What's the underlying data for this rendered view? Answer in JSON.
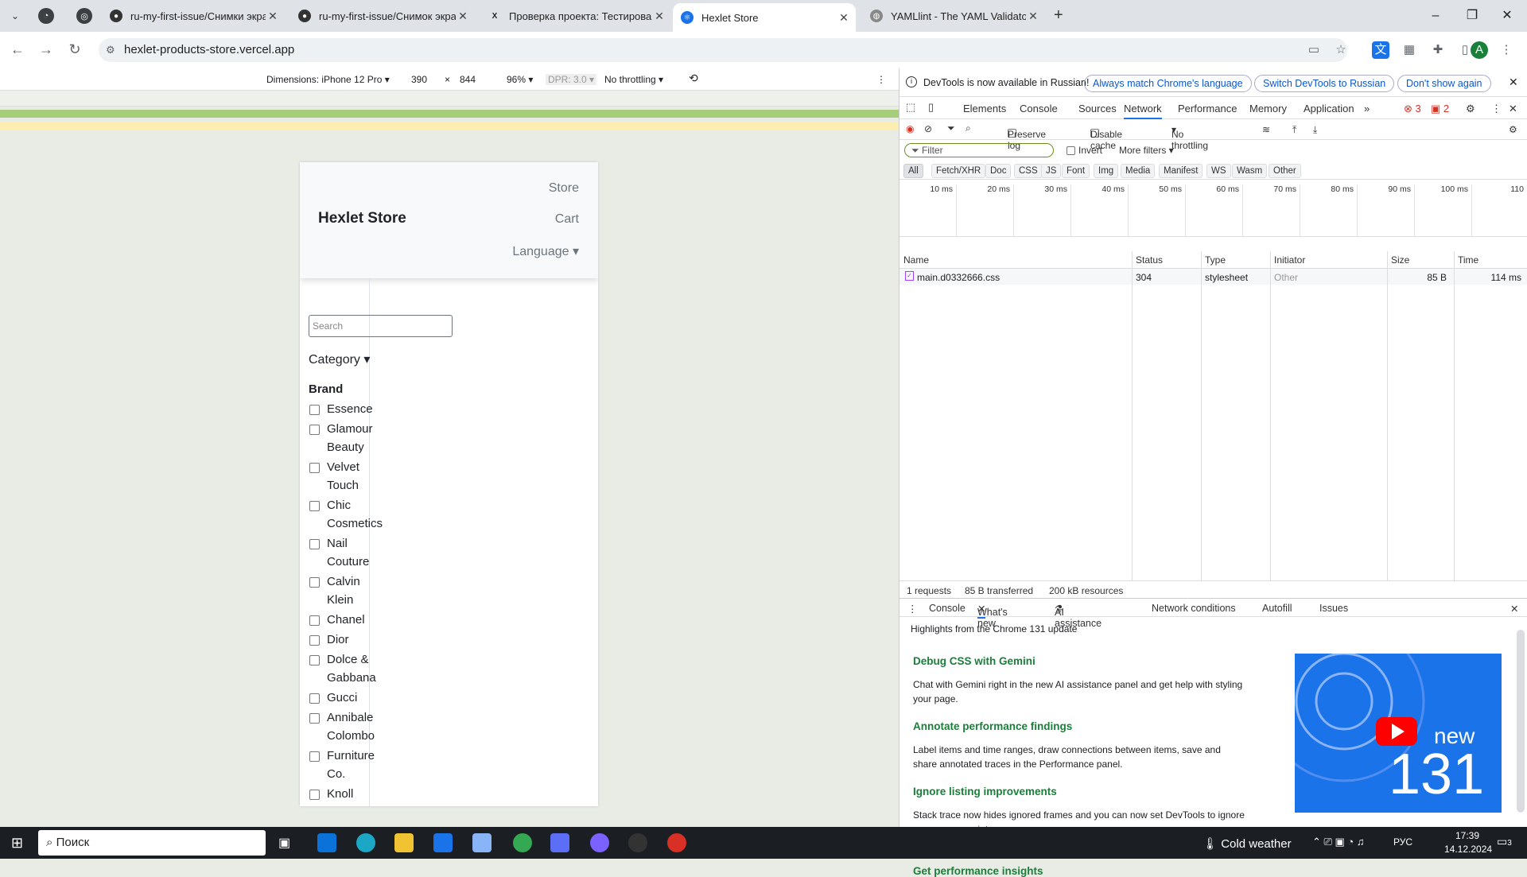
{
  "browser": {
    "tabs": [
      {
        "title": "ru-my-first-issue/Снимки экра",
        "icon": "github-icon"
      },
      {
        "title": "ru-my-first-issue/Снимок экра",
        "icon": "github-icon"
      },
      {
        "title": "Проверка проекта: Тестирова",
        "icon": "hexlet-icon"
      },
      {
        "title": "Hexlet Store",
        "icon": "react-icon",
        "active": true
      },
      {
        "title": "YAMLlint - The YAML Validator",
        "icon": "globe-icon"
      }
    ],
    "url": "hexlet-products-store.vercel.app"
  },
  "device_toolbar": {
    "dimensions": "Dimensions: iPhone 12 Pro",
    "width": "390",
    "times": "×",
    "height": "844",
    "zoom": "96%",
    "dpr": "DPR: 3.0",
    "throttling": "No throttling"
  },
  "page": {
    "brand": "Hexlet Store",
    "nav": [
      "Store",
      "Cart",
      "Language"
    ],
    "search_placeholder": "Search",
    "category": "Category",
    "brand_heading": "Brand",
    "brands": [
      "Essence",
      "Glamour Beauty",
      "Velvet Touch",
      "Chic Cosmetics",
      "Nail Couture",
      "Calvin Klein",
      "Chanel",
      "Dior",
      "Dolce & Gabbana",
      "Gucci",
      "Annibale Colombo",
      "Furniture Co.",
      "Knoll"
    ]
  },
  "devtools": {
    "banner_text": "DevTools is now available in Russian!",
    "banner_buttons": [
      "Always match Chrome's language",
      "Switch DevTools to Russian",
      "Don't show again"
    ],
    "tabs": [
      "Elements",
      "Console",
      "Sources",
      "Network",
      "Performance",
      "Memory",
      "Application"
    ],
    "active_tab": "Network",
    "error_count": "3",
    "warning_count": "2",
    "preserve_log": "Preserve log",
    "disable_cache": "Disable cache",
    "throttling": "No throttling",
    "filter_placeholder": "Filter",
    "invert": "Invert",
    "more_filters": "More filters",
    "type_filters": [
      "All",
      "Fetch/XHR",
      "Doc",
      "CSS",
      "JS",
      "Font",
      "Img",
      "Media",
      "Manifest",
      "WS",
      "Wasm",
      "Other"
    ],
    "timeline_ticks": [
      "10 ms",
      "20 ms",
      "30 ms",
      "40 ms",
      "50 ms",
      "60 ms",
      "70 ms",
      "80 ms",
      "90 ms",
      "100 ms",
      "110"
    ],
    "columns": [
      "Name",
      "Status",
      "Type",
      "Initiator",
      "Size",
      "Time"
    ],
    "rows": [
      {
        "name": "main.d0332666.css",
        "status": "304",
        "type": "stylesheet",
        "initiator": "Other",
        "size": "85 B",
        "time": "114 ms"
      }
    ],
    "summary": [
      "1 requests",
      "85 B transferred",
      "200 kB resources"
    ],
    "drawer_tabs": [
      "Console",
      "What's new",
      "AI assistance",
      "Network conditions",
      "Autofill",
      "Issues"
    ],
    "whats_new": {
      "headline": "Highlights from the Chrome 131 update",
      "items": [
        {
          "title": "Debug CSS with Gemini",
          "body": "Chat with Gemini right in the new AI assistance panel and get help with styling your page."
        },
        {
          "title": "Annotate performance findings",
          "body": "Label items and time ranges, draw connections between items, save and share annotated traces in the Performance panel."
        },
        {
          "title": "Ignore listing improvements",
          "body": "Stack trace now hides ignored frames and you can now set DevTools to ignore anonymous scripts."
        },
        {
          "title": "Get performance insights",
          "body": ""
        }
      ],
      "promo_new": "new",
      "promo_number": "131"
    }
  },
  "taskbar": {
    "search": "Поиск",
    "weather": "Cold weather",
    "lang": "РУС",
    "time": "17:39",
    "date": "14.12.2024",
    "notifications": "3"
  },
  "colors": {
    "devtools_accent": "#1a73e8",
    "green_title": "#188038",
    "timeline_green": "#a6ce7a"
  }
}
